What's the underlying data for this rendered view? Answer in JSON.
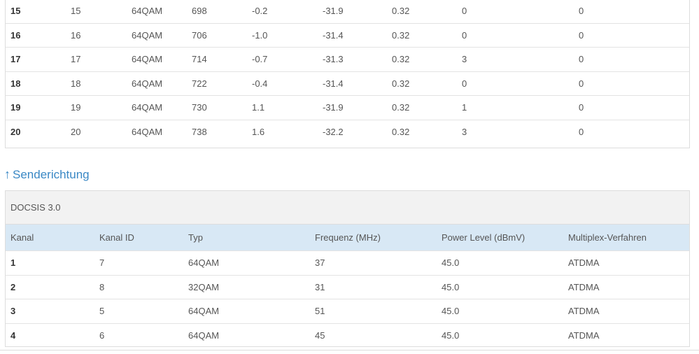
{
  "downstream": {
    "rows": [
      [
        "15",
        "15",
        "64QAM",
        "698",
        "-0.2",
        "-31.9",
        "0.32",
        "0",
        "0"
      ],
      [
        "16",
        "16",
        "64QAM",
        "706",
        "-1.0",
        "-31.4",
        "0.32",
        "0",
        "0"
      ],
      [
        "17",
        "17",
        "64QAM",
        "714",
        "-0.7",
        "-31.3",
        "0.32",
        "3",
        "0"
      ],
      [
        "18",
        "18",
        "64QAM",
        "722",
        "-0.4",
        "-31.4",
        "0.32",
        "0",
        "0"
      ],
      [
        "19",
        "19",
        "64QAM",
        "730",
        "1.1",
        "-31.9",
        "0.32",
        "1",
        "0"
      ],
      [
        "20",
        "20",
        "64QAM",
        "738",
        "1.6",
        "-32.2",
        "0.32",
        "3",
        "0"
      ]
    ]
  },
  "upstream": {
    "arrow": "↑",
    "heading": "Senderichtung",
    "docsis_label": "DOCSIS 3.0",
    "headers": [
      "Kanal",
      "Kanal ID",
      "Typ",
      "Frequenz (MHz)",
      "Power Level (dBmV)",
      "Multiplex-Verfahren"
    ],
    "rows": [
      [
        "1",
        "7",
        "64QAM",
        "37",
        "45.0",
        "ATDMA"
      ],
      [
        "2",
        "8",
        "32QAM",
        "31",
        "45.0",
        "ATDMA"
      ],
      [
        "3",
        "5",
        "64QAM",
        "51",
        "45.0",
        "ATDMA"
      ],
      [
        "4",
        "6",
        "64QAM",
        "45",
        "45.0",
        "ATDMA"
      ]
    ]
  },
  "colors": {
    "link_blue": "#3a88c5",
    "header_bg": "#d8e8f5",
    "docsis_bg": "#f2f2f2"
  }
}
